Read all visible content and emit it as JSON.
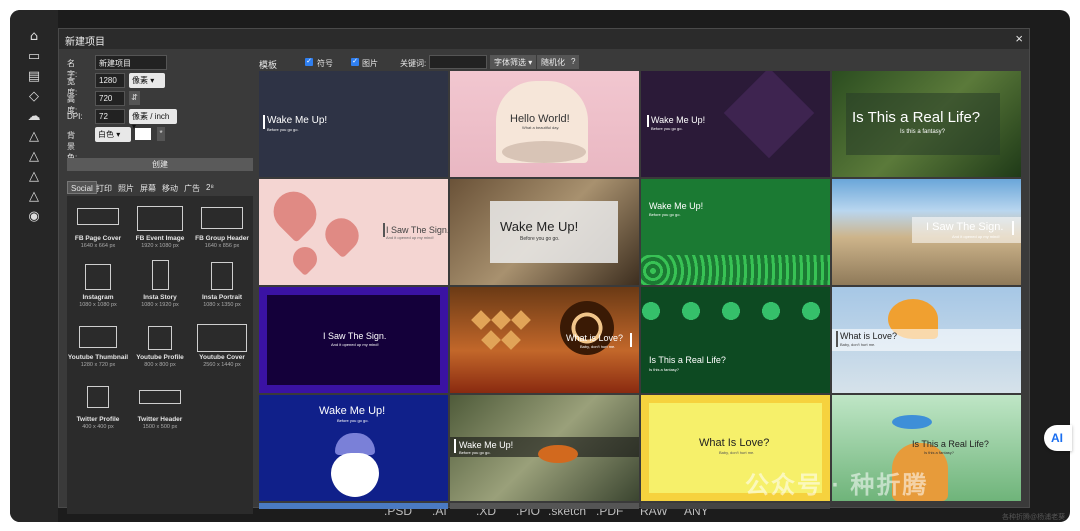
{
  "dialog": {
    "title": "新建项目",
    "close_label": "×"
  },
  "form": {
    "name_label": "名字:",
    "name_value": "新建项目",
    "width_label": "宽度:",
    "width_value": "1280",
    "width_unit": "像素 ▾",
    "height_label": "高度:",
    "height_value": "720",
    "swap_label": "⇵",
    "dpi_label": "DPI:",
    "dpi_value": "72",
    "dpi_unit": "像素 / inch ▾",
    "bg_label": "背景色:",
    "bg_value": "白色 ▾",
    "bg_more": "*",
    "create_label": "创建"
  },
  "categories": [
    {
      "label": "Social",
      "active": true
    },
    {
      "label": "打印"
    },
    {
      "label": "照片"
    },
    {
      "label": "屏幕"
    },
    {
      "label": "移动"
    },
    {
      "label": "广告"
    },
    {
      "label": "2⁸"
    }
  ],
  "presets": [
    {
      "name": "FB Page Cover",
      "size": "1640 x 664 px"
    },
    {
      "name": "FB Event Image",
      "size": "1920 x 1080 px"
    },
    {
      "name": "FB Group Header",
      "size": "1640 x 856 px"
    },
    {
      "name": "Instagram",
      "size": "1080 x 1080 px"
    },
    {
      "name": "Insta Story",
      "size": "1080 x 1920 px"
    },
    {
      "name": "Insta Portrait",
      "size": "1080 x 1350 px"
    },
    {
      "name": "Youtube Thumbnail",
      "size": "1280 x 720 px"
    },
    {
      "name": "Youtube Profile",
      "size": "800 x 800 px"
    },
    {
      "name": "Youtube Cover",
      "size": "2560 x 1440 px"
    },
    {
      "name": "Twitter Profile",
      "size": "400 x 400 px"
    },
    {
      "name": "Twitter Header",
      "size": "1500 x 500 px"
    }
  ],
  "toolbar": {
    "templates_label": "模板",
    "symbol_label": "符号",
    "image_label": "图片",
    "keyword_label": "关键词:",
    "font_filter_label": "字体筛选 ▾",
    "random_label": "随机化",
    "help_label": "?"
  },
  "templates": [
    {
      "title": "Wake Me Up!",
      "sub": "Before you go go."
    },
    {
      "title": "Hello World!",
      "sub": "What a beautiful day."
    },
    {
      "title": "Wake Me Up!",
      "sub": "Before you go go."
    },
    {
      "title": "Is This a Real Life?",
      "sub": "Is this a fantasy?"
    },
    {
      "title": "I Saw The Sign.",
      "sub": "And it opened up my mind!"
    },
    {
      "title": "Wake Me Up!",
      "sub": "Before you go go."
    },
    {
      "title": "Wake Me Up!",
      "sub": "Before you go go."
    },
    {
      "title": "I Saw The Sign.",
      "sub": "And it opened up my mind!"
    },
    {
      "title": "I Saw The Sign.",
      "sub": "And it opened up my mind!"
    },
    {
      "title": "What is Love?",
      "sub": "Baby, don't hurt me."
    },
    {
      "title": "Is This a Real Life?",
      "sub": "Is this a fantasy?"
    },
    {
      "title": "What is Love?",
      "sub": "Baby, don't hurt me."
    },
    {
      "title": "Wake Me Up!",
      "sub": "Before you go go."
    },
    {
      "title": "Wake Me Up!",
      "sub": "Before you go go."
    },
    {
      "title": "What Is Love?",
      "sub": "Baby, don't hurt me."
    },
    {
      "title": "Is This a Real Life?",
      "sub": "Is this a fantasy?"
    }
  ],
  "formats": [
    ".PSD",
    ".AI",
    ".XD",
    ".PIO",
    ".sketch",
    ".PDF",
    "RAW",
    "ANY"
  ],
  "watermark": {
    "text": "公众号 · 种折腾",
    "credit": "各种折腾@杨浦老葵"
  },
  "badge": {
    "text": "AI"
  }
}
